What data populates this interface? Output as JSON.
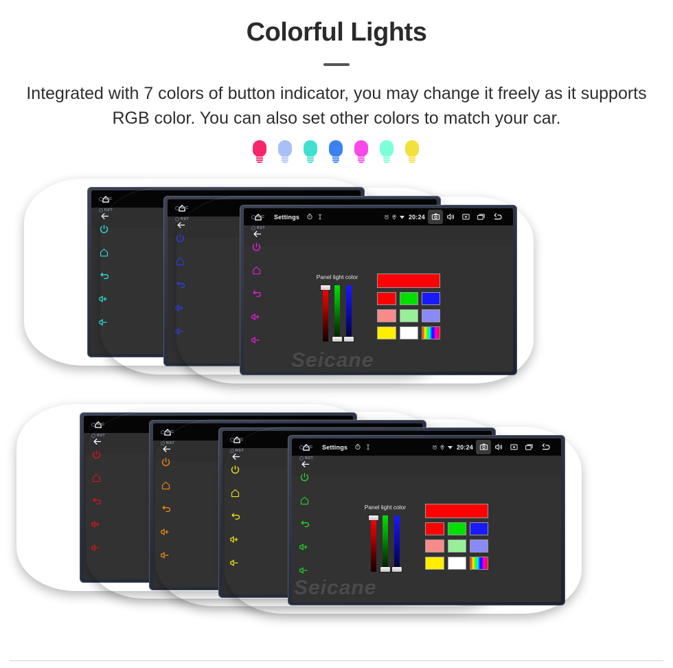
{
  "header": {
    "title": "Colorful Lights",
    "subtitle": "Integrated with 7 colors of button indicator, you may change it freely as it supports RGB color. You can also set other colors to match your car."
  },
  "legend": {
    "items": [
      {
        "label": "red",
        "color": "#f7266b"
      },
      {
        "label": "Light blue",
        "color": "#a8c0f5"
      },
      {
        "label": "cyan",
        "color": "#3fe0d0"
      },
      {
        "label": "blue",
        "color": "#3b82f0"
      },
      {
        "label": "pink",
        "color": "#f849e8"
      },
      {
        "label": "light cyan",
        "color": "#7dffd8"
      },
      {
        "label": "yellow",
        "color": "#f2e13c"
      }
    ]
  },
  "watermark": {
    "text": "Seicane"
  },
  "rows": [
    {
      "name": "top-row",
      "units": [
        {
          "button_color": "#2fe0d8",
          "label": "cyan-unit"
        },
        {
          "button_color": "#2a3cf0",
          "label": "blue-unit"
        },
        {
          "button_color": "#e81ce0",
          "label": "magenta-unit"
        }
      ]
    },
    {
      "name": "bottom-row",
      "units": [
        {
          "button_color": "#e01414",
          "label": "red-unit"
        },
        {
          "button_color": "#f08a14",
          "label": "orange-unit"
        },
        {
          "button_color": "#ece216",
          "label": "yellow-unit"
        },
        {
          "button_color": "#21d626",
          "label": "green-unit"
        }
      ]
    }
  ],
  "head_unit": {
    "hardware_buttons": {
      "mic_label": "MIC",
      "rst_label": "RST",
      "icons": [
        "power-icon",
        "home-icon",
        "back-icon",
        "volume-up-icon",
        "volume-down-icon"
      ]
    },
    "status_bar": {
      "home_icon": "home-icon",
      "title": "Settings",
      "timer_icon": "timer-icon",
      "usb_icon": "usb-icon",
      "alarm_icon": "alarm-icon",
      "location_icon": "location-icon",
      "wifi_icon": "wifi-icon",
      "time": "20:24",
      "camera_icon": "camera-icon",
      "volume_icon": "volume-icon",
      "close_icon": "close-box-icon",
      "recents_icon": "recent-apps-icon",
      "back_icon": "back-arrow-icon"
    },
    "action_bar": {
      "back_icon": "back-arrow-icon"
    },
    "color_panel": {
      "label": "Panel light color",
      "sliders": [
        {
          "name": "red-slider",
          "handle": "top",
          "value": 100
        },
        {
          "name": "green-slider",
          "handle": "bottom",
          "value": 0
        },
        {
          "name": "blue-slider",
          "handle": "bottom",
          "value": 0
        }
      ],
      "preview_color": "#ff0000",
      "swatch_rows": [
        [
          "#ff0000",
          "#00e000",
          "#1a1aff"
        ],
        [
          "#f78a8a",
          "#97ef97",
          "#8a8af7"
        ],
        [
          "#ffee00",
          "#ffffff",
          "rainbow"
        ]
      ]
    }
  }
}
